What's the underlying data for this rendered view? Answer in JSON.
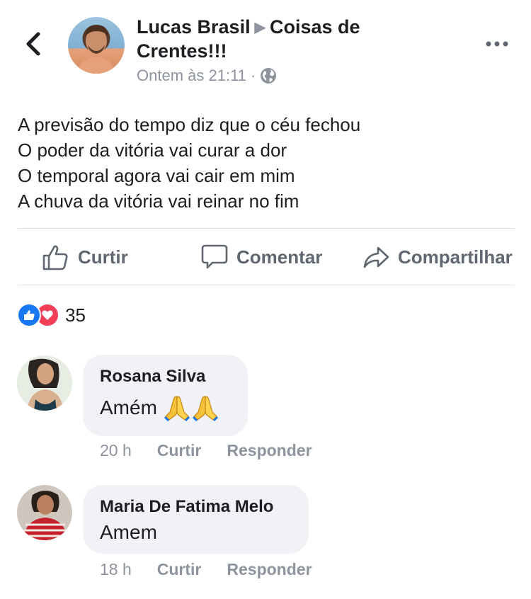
{
  "post": {
    "author": "Lucas Brasil",
    "group_line1": "Coisas de",
    "group_line2": "Crentes!!!",
    "time": "Ontem às 21:11",
    "separator": "·",
    "privacy_icon": "globe-icon",
    "lines": [
      "A previsão do tempo diz que o céu fechou",
      "O poder da vitória vai curar a dor",
      "O temporal agora vai cair em mim",
      "A chuva da vitória vai reinar no fim"
    ]
  },
  "actions": {
    "like": "Curtir",
    "comment": "Comentar",
    "share": "Compartilhar"
  },
  "reactions": {
    "count": "35",
    "types": [
      "like",
      "love"
    ]
  },
  "comments": [
    {
      "author": "Rosana Silva",
      "text": "Amém",
      "emoji": "🙏🙏",
      "time": "20 h",
      "like_label": "Curtir",
      "reply_label": "Responder"
    },
    {
      "author": "Maria De Fatima Melo",
      "text": "Amem",
      "time": "18 h",
      "like_label": "Curtir",
      "reply_label": "Responder"
    }
  ],
  "colors": {
    "text": "#1c1e21",
    "muted": "#8d949e",
    "action": "#606770",
    "like_blue": "#1877f2",
    "love_red": "#f33e58",
    "bubble": "#f0f2f5",
    "divider": "#dadde1"
  }
}
